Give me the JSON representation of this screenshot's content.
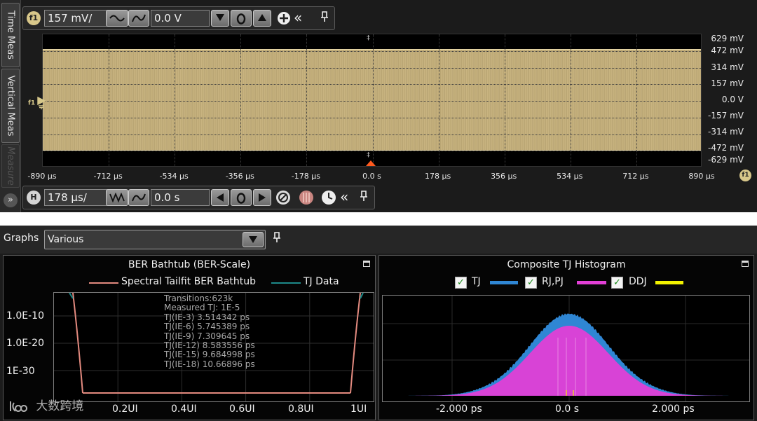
{
  "side_tabs": [
    "Time Meas",
    "Vertical Meas",
    "Measure"
  ],
  "vertical_bar": {
    "channel_badge": "f1",
    "scale": "157 mV/",
    "offset": "0.0 V"
  },
  "horizontal_bar": {
    "badge": "H",
    "scale": "178 µs/",
    "delay": "0.0 s"
  },
  "waveform": {
    "y_labels": [
      "629 mV",
      "472 mV",
      "314 mV",
      "157 mV",
      "0.0 V",
      "-157 mV",
      "-314 mV",
      "-472 mV",
      "-629 mV"
    ],
    "x_labels": [
      "-890 µs",
      "-712 µs",
      "-534 µs",
      "-356 µs",
      "-178 µs",
      "0.0 s",
      "178 µs",
      "356 µs",
      "534 µs",
      "712 µs",
      "890 µs"
    ],
    "trace_color": "#c7b27f",
    "ground_marker": "f1",
    "corner_badge": "f1"
  },
  "graphs": {
    "label": "Graphs",
    "selection": "Various"
  },
  "bathtub": {
    "title": "BER Bathtub (BER-Scale)",
    "legend": [
      {
        "name": "Spectral Tailfit BER Bathtub",
        "color": "#e38a7f"
      },
      {
        "name": "TJ Data",
        "color": "#1d8a8a"
      }
    ],
    "y_ticks": [
      "1.0E-10",
      "1.0E-20",
      "1E-30"
    ],
    "x_ticks": [
      "0.2UI",
      "0.4UI",
      "0.6UI",
      "0.8UI",
      "1UI"
    ],
    "annotations": [
      "Transitions:623k",
      "Measured TJ: 1E-5",
      "TJ(IE-3) 3.514342 ps",
      "TJ(IE-6) 5.745389 ps",
      "TJ(IE-9) 7.309645 ps",
      "TJ(IE-12) 8.583556 ps",
      "TJ(IE-15) 9.684998 ps",
      "TJ(IE-18) 10.66896 ps"
    ]
  },
  "histogram": {
    "title": "Composite TJ Histogram",
    "legend": [
      {
        "name": "TJ",
        "color": "#2f86d4"
      },
      {
        "name": "RJ,PJ",
        "color": "#e23fd6"
      },
      {
        "name": "DDJ",
        "color": "#f2f200"
      }
    ],
    "x_ticks": [
      "-2.000 ps",
      "0.0 s",
      "2.000 ps"
    ]
  },
  "watermark": "大数跨境"
}
